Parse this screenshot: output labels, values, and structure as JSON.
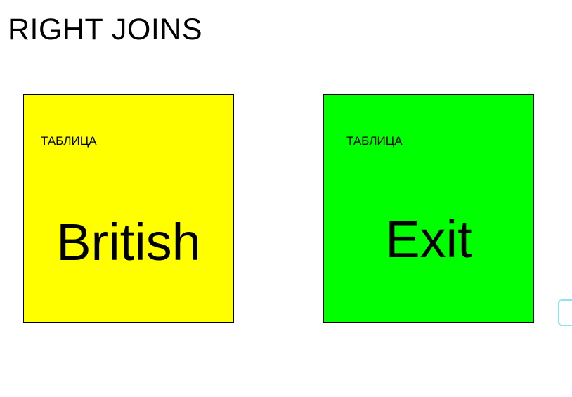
{
  "slide": {
    "title": "RIGHT JOINS"
  },
  "tables": [
    {
      "label": "ТАБЛИЦА",
      "name": "British",
      "color": "#ffff00"
    },
    {
      "label": "ТАБЛИЦА",
      "name": "Exit",
      "color": "#00ff00"
    }
  ],
  "colors": {
    "background": "#ffffff",
    "text": "#000000",
    "edge_widget_border": "#8fe3ec"
  }
}
